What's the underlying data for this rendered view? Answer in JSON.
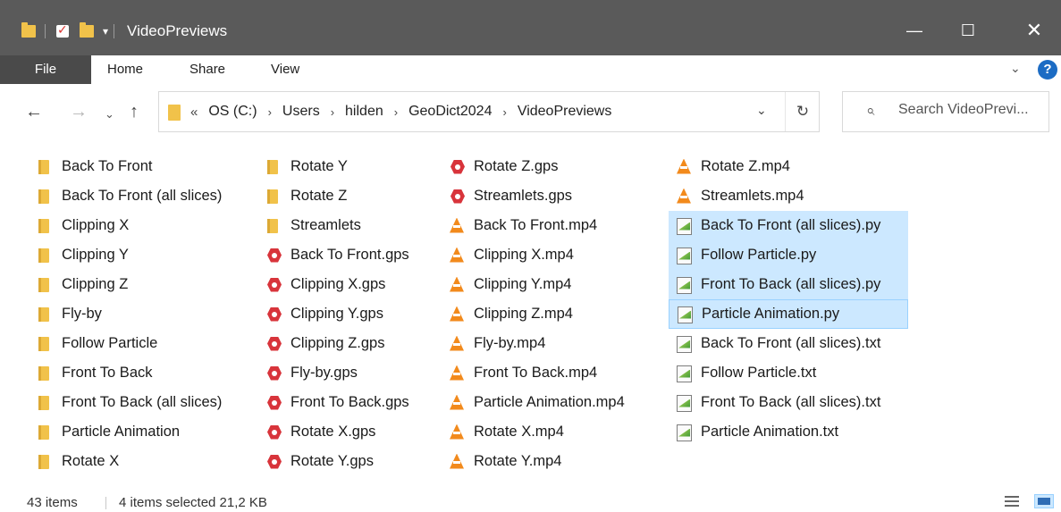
{
  "window": {
    "title": "VideoPreviews",
    "controls": {
      "minimize": "—",
      "maximize": "☐",
      "close": "✕"
    },
    "qat_dropdown": "▾"
  },
  "ribbon": {
    "tabs": [
      "File",
      "Home",
      "Share",
      "View"
    ],
    "expand_glyph": "⌄",
    "help_glyph": "?"
  },
  "nav": {
    "back": "←",
    "forward": "→",
    "recent": "⌄",
    "up": "↑",
    "lead": "«",
    "breadcrumb": [
      "OS (C:)",
      "Users",
      "hilden",
      "GeoDict2024",
      "VideoPreviews"
    ],
    "separator": "›",
    "dropdown": "⌄",
    "refresh": "↻"
  },
  "search": {
    "placeholder": "Search VideoPrevi...",
    "icon": "⌕"
  },
  "files": {
    "columns": [
      [
        {
          "name": "Back To Front",
          "type": "folder"
        },
        {
          "name": "Back To Front (all slices)",
          "type": "folder"
        },
        {
          "name": "Clipping X",
          "type": "folder"
        },
        {
          "name": "Clipping Y",
          "type": "folder"
        },
        {
          "name": "Clipping Z",
          "type": "folder"
        },
        {
          "name": "Fly-by",
          "type": "folder"
        },
        {
          "name": "Follow Particle",
          "type": "folder"
        },
        {
          "name": "Front To Back",
          "type": "folder"
        },
        {
          "name": "Front To Back (all slices)",
          "type": "folder"
        },
        {
          "name": "Particle Animation",
          "type": "folder"
        },
        {
          "name": "Rotate X",
          "type": "folder"
        }
      ],
      [
        {
          "name": "Rotate Y",
          "type": "folder"
        },
        {
          "name": "Rotate Z",
          "type": "folder"
        },
        {
          "name": "Streamlets",
          "type": "folder"
        },
        {
          "name": "Back To Front.gps",
          "type": "gps"
        },
        {
          "name": "Clipping X.gps",
          "type": "gps"
        },
        {
          "name": "Clipping Y.gps",
          "type": "gps"
        },
        {
          "name": "Clipping Z.gps",
          "type": "gps"
        },
        {
          "name": "Fly-by.gps",
          "type": "gps"
        },
        {
          "name": "Front To Back.gps",
          "type": "gps"
        },
        {
          "name": "Rotate X.gps",
          "type": "gps"
        },
        {
          "name": "Rotate Y.gps",
          "type": "gps"
        }
      ],
      [
        {
          "name": "Rotate Z.gps",
          "type": "gps"
        },
        {
          "name": "Streamlets.gps",
          "type": "gps"
        },
        {
          "name": "Back To Front.mp4",
          "type": "vlc"
        },
        {
          "name": "Clipping X.mp4",
          "type": "vlc"
        },
        {
          "name": "Clipping Y.mp4",
          "type": "vlc"
        },
        {
          "name": "Clipping Z.mp4",
          "type": "vlc"
        },
        {
          "name": "Fly-by.mp4",
          "type": "vlc"
        },
        {
          "name": "Front To Back.mp4",
          "type": "vlc"
        },
        {
          "name": "Particle Animation.mp4",
          "type": "vlc"
        },
        {
          "name": "Rotate X.mp4",
          "type": "vlc"
        },
        {
          "name": "Rotate Y.mp4",
          "type": "vlc"
        }
      ],
      [
        {
          "name": "Rotate Z.mp4",
          "type": "vlc"
        },
        {
          "name": "Streamlets.mp4",
          "type": "vlc"
        },
        {
          "name": "Back To Front (all slices).py",
          "type": "py",
          "selected": true
        },
        {
          "name": "Follow Particle.py",
          "type": "py",
          "selected": true
        },
        {
          "name": "Front To Back (all slices).py",
          "type": "py",
          "selected": true
        },
        {
          "name": "Particle Animation.py",
          "type": "py",
          "selected": true,
          "focused": true
        },
        {
          "name": "Back To Front (all slices).txt",
          "type": "py"
        },
        {
          "name": "Follow Particle.txt",
          "type": "py"
        },
        {
          "name": "Front To Back (all slices).txt",
          "type": "py"
        },
        {
          "name": "Particle Animation.txt",
          "type": "py"
        }
      ]
    ]
  },
  "status": {
    "item_count": "43 items",
    "selection": "4 items selected  21,2 KB"
  },
  "colors": {
    "titlebar": "#5a5a5a",
    "file_tab": "#4a4a4a",
    "selection": "#cce8ff",
    "selection_border": "#99d1ff",
    "folder": "#f1c24a",
    "gps": "#d8343b",
    "vlc": "#f28a1c",
    "help": "#1c6cc4"
  }
}
